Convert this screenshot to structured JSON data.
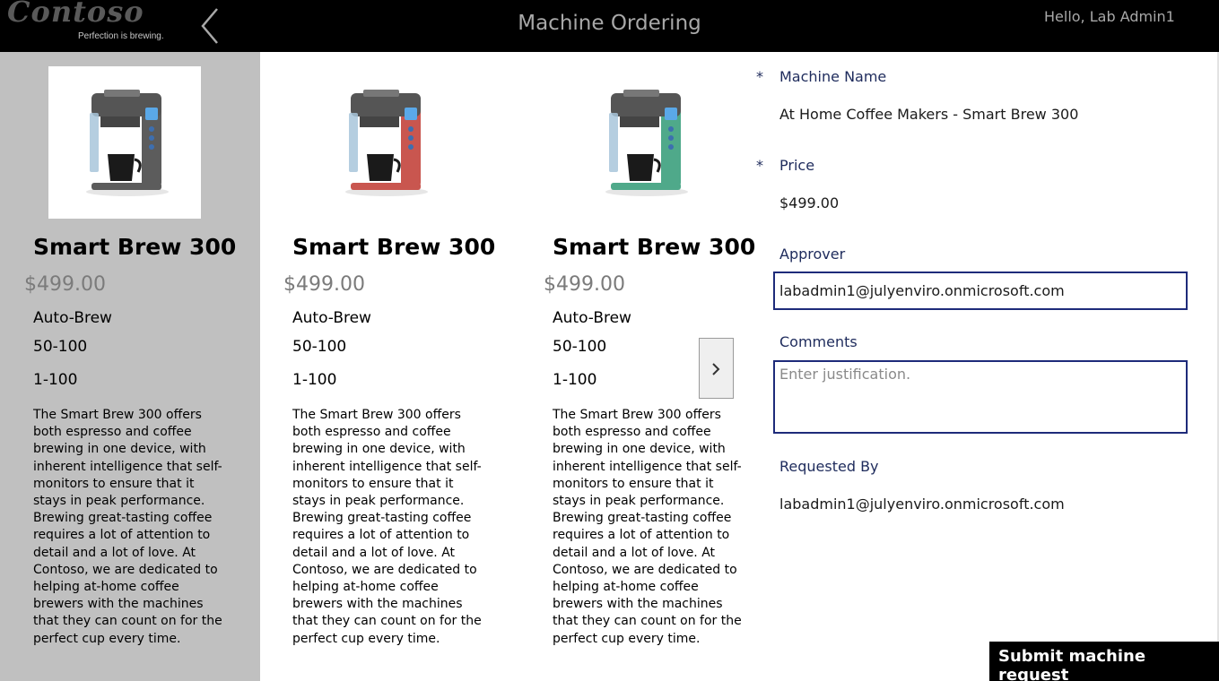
{
  "header": {
    "logo_text": "Contoso",
    "logo_tagline": "Perfection is brewing.",
    "title": "Machine Ordering",
    "greeting": "Hello, Lab Admin1",
    "back_icon": "chevron-left-icon"
  },
  "gallery": {
    "items": [
      {
        "name": "Smart Brew 300",
        "price": "$499.00",
        "type": "Auto-Brew",
        "capacity": "50-100",
        "quantity": "1-100",
        "description": "The Smart Brew 300 offers both espresso and coffee brewing in one device, with inherent intelligence that self-monitors to ensure that it stays in peak performance. Brewing great-tasting coffee requires a lot of attention to detail and a lot of love. At Contoso, we are dedicated to helping at-home coffee brewers with the machines that they can count on for the perfect cup every time.",
        "body_color": "#5c5c5c",
        "selected": true
      },
      {
        "name": "Smart Brew 300",
        "price": "$499.00",
        "type": "Auto-Brew",
        "capacity": "50-100",
        "quantity": "1-100",
        "description": "The Smart Brew 300 offers both espresso and coffee brewing in one device, with inherent intelligence that self-monitors to ensure that it stays in peak performance. Brewing great-tasting coffee requires a lot of attention to detail and a lot of love. At Contoso, we are dedicated to helping at-home coffee brewers with the machines that they can count on for the perfect cup every time.",
        "body_color": "#c9564f",
        "selected": false
      },
      {
        "name": "Smart Brew 300",
        "price": "$499.00",
        "type": "Auto-Brew",
        "capacity": "50-100",
        "quantity": "1-100",
        "description": "The Smart Brew 300 offers both espresso and coffee brewing in one device, with inherent intelligence that self-monitors to ensure that it stays in peak performance. Brewing great-tasting coffee requires a lot of attention to detail and a lot of love. At Contoso, we are dedicated to helping at-home coffee brewers with the machines that they can count on for the perfect cup every time.",
        "body_color": "#4fa98a",
        "selected": false
      }
    ],
    "next_icon": "chevron-right-icon"
  },
  "form": {
    "machine_name_label": "Machine Name",
    "machine_name_value": "At Home Coffee Makers - Smart Brew 300",
    "price_label": "Price",
    "price_value": "$499.00",
    "required_marker": "*",
    "approver_label": "Approver",
    "approver_value": "labadmin1@julyenviro.onmicrosoft.com",
    "comments_label": "Comments",
    "comments_placeholder": "Enter justification.",
    "requested_by_label": "Requested By",
    "requested_by_value": "labadmin1@julyenviro.onmicrosoft.com",
    "submit_label": "Submit machine request"
  },
  "colors": {
    "header_bg": "#000000",
    "selected_card_bg": "#c0c0c0",
    "label_color": "#1e2b5c",
    "input_border": "#1e2b7a"
  }
}
